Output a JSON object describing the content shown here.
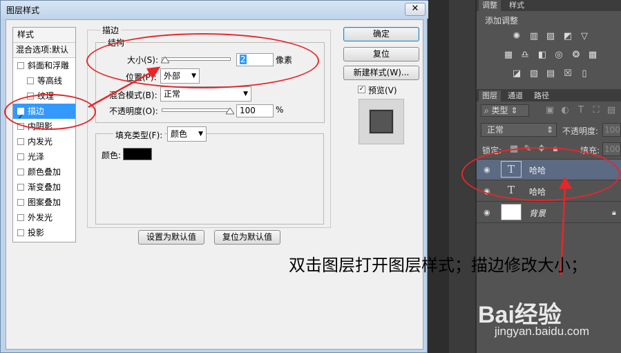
{
  "dialog": {
    "title": "图层样式",
    "close_glyph": "✕",
    "style_list": {
      "header": "样式",
      "blend_options": "混合选项:默认",
      "items": [
        {
          "label": "斜面和浮雕",
          "checked": false
        },
        {
          "label": "等高线",
          "checked": false,
          "sub": true
        },
        {
          "label": "纹理",
          "checked": false,
          "sub": true
        },
        {
          "label": "描边",
          "checked": true,
          "selected": true
        },
        {
          "label": "内阴影",
          "checked": false
        },
        {
          "label": "内发光",
          "checked": false
        },
        {
          "label": "光泽",
          "checked": false
        },
        {
          "label": "颜色叠加",
          "checked": false
        },
        {
          "label": "渐变叠加",
          "checked": false
        },
        {
          "label": "图案叠加",
          "checked": false
        },
        {
          "label": "外发光",
          "checked": false
        },
        {
          "label": "投影",
          "checked": false
        }
      ]
    },
    "stroke": {
      "section_title": "描边",
      "structure_title": "结构",
      "size_label": "大小(S):",
      "size_value": "2",
      "size_unit": "像素",
      "position_label": "位置(P):",
      "position_value": "外部",
      "blend_label": "混合模式(B):",
      "blend_value": "正常",
      "opacity_label": "不透明度(O):",
      "opacity_value": "100",
      "opacity_unit": "%",
      "fill_type_label": "填充类型(F):",
      "fill_type_value": "颜色",
      "color_label": "颜色:",
      "color_hex": "#000000",
      "set_default": "设置为默认值",
      "reset_default": "复位为默认值"
    },
    "buttons": {
      "ok": "确定",
      "reset": "复位",
      "new_style": "新建样式(W)...",
      "preview_label": "预览(V)",
      "preview_checked": true
    }
  },
  "panels": {
    "adjust_tabs": [
      "调整",
      "样式"
    ],
    "adjust_title": "添加调整",
    "layer_tabs": [
      "图层",
      "通道",
      "路径"
    ],
    "filter_label": "类型",
    "blend_mode": "正常",
    "opacity_label": "不透明度:",
    "opacity_value": "100%",
    "lock_label": "锁定:",
    "fill_label": "填充:",
    "fill_value": "100%",
    "layers": [
      {
        "name": "哈哈",
        "type": "text",
        "selected": true
      },
      {
        "name": "哈哈",
        "type": "text",
        "selected": false
      },
      {
        "name": "背景",
        "type": "image",
        "selected": false
      }
    ]
  },
  "annotation": {
    "text": "双击图层打开图层样式；描边修改大小；",
    "color": "#e8262a"
  },
  "watermark": {
    "brand": "Bai经验",
    "url": "jingyan.baidu.com"
  }
}
